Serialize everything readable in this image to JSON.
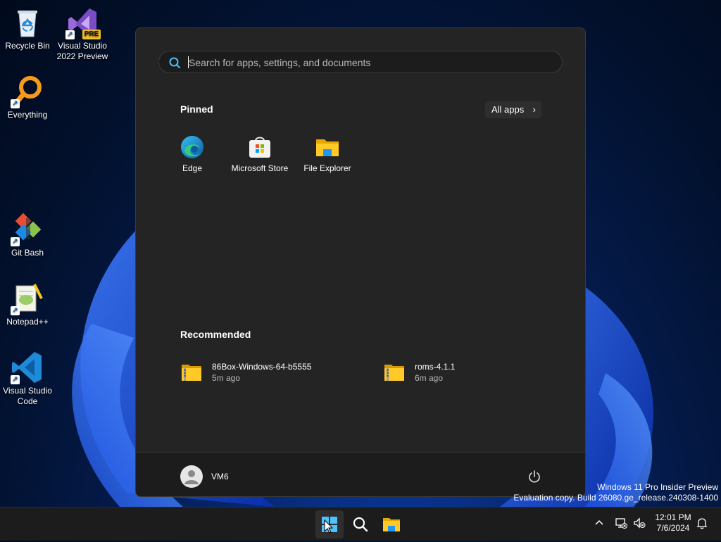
{
  "desktop": {
    "icons": [
      {
        "label": "Recycle Bin",
        "icon": "recycle-bin-icon"
      },
      {
        "label": "Visual Studio 2022 Preview",
        "icon": "visual-studio-icon",
        "badge": "PRE"
      },
      {
        "label": "Everything",
        "icon": "everything-search-icon"
      },
      {
        "label": "Git Bash",
        "icon": "git-bash-icon"
      },
      {
        "label": "Notepad++",
        "icon": "notepad-plus-plus-icon"
      },
      {
        "label": "Visual Studio Code",
        "icon": "vscode-icon"
      }
    ]
  },
  "start_menu": {
    "search_placeholder": "Search for apps, settings, and documents",
    "pinned_title": "Pinned",
    "all_apps_label": "All apps",
    "pinned": [
      {
        "label": "Edge",
        "icon": "edge-icon"
      },
      {
        "label": "Microsoft Store",
        "icon": "microsoft-store-icon"
      },
      {
        "label": "File Explorer",
        "icon": "file-explorer-icon"
      }
    ],
    "recommended_title": "Recommended",
    "recommended": [
      {
        "name": "86Box-Windows-64-b5555",
        "time": "5m ago",
        "icon": "zip-folder-icon"
      },
      {
        "name": "roms-4.1.1",
        "time": "6m ago",
        "icon": "zip-folder-icon"
      }
    ],
    "user": {
      "name": "VM6"
    },
    "power_icon": "power-icon"
  },
  "watermark": {
    "line1": "Windows 11 Pro Insider Preview",
    "line2": "Evaluation copy. Build 26080.ge_release.240308-1400"
  },
  "taskbar": {
    "clock_time": "12:01 PM",
    "clock_date": "7/6/2024"
  },
  "colors": {
    "accent": "#0078d4",
    "menu_bg": "#242424",
    "taskbar_bg": "#1c1c1c"
  }
}
